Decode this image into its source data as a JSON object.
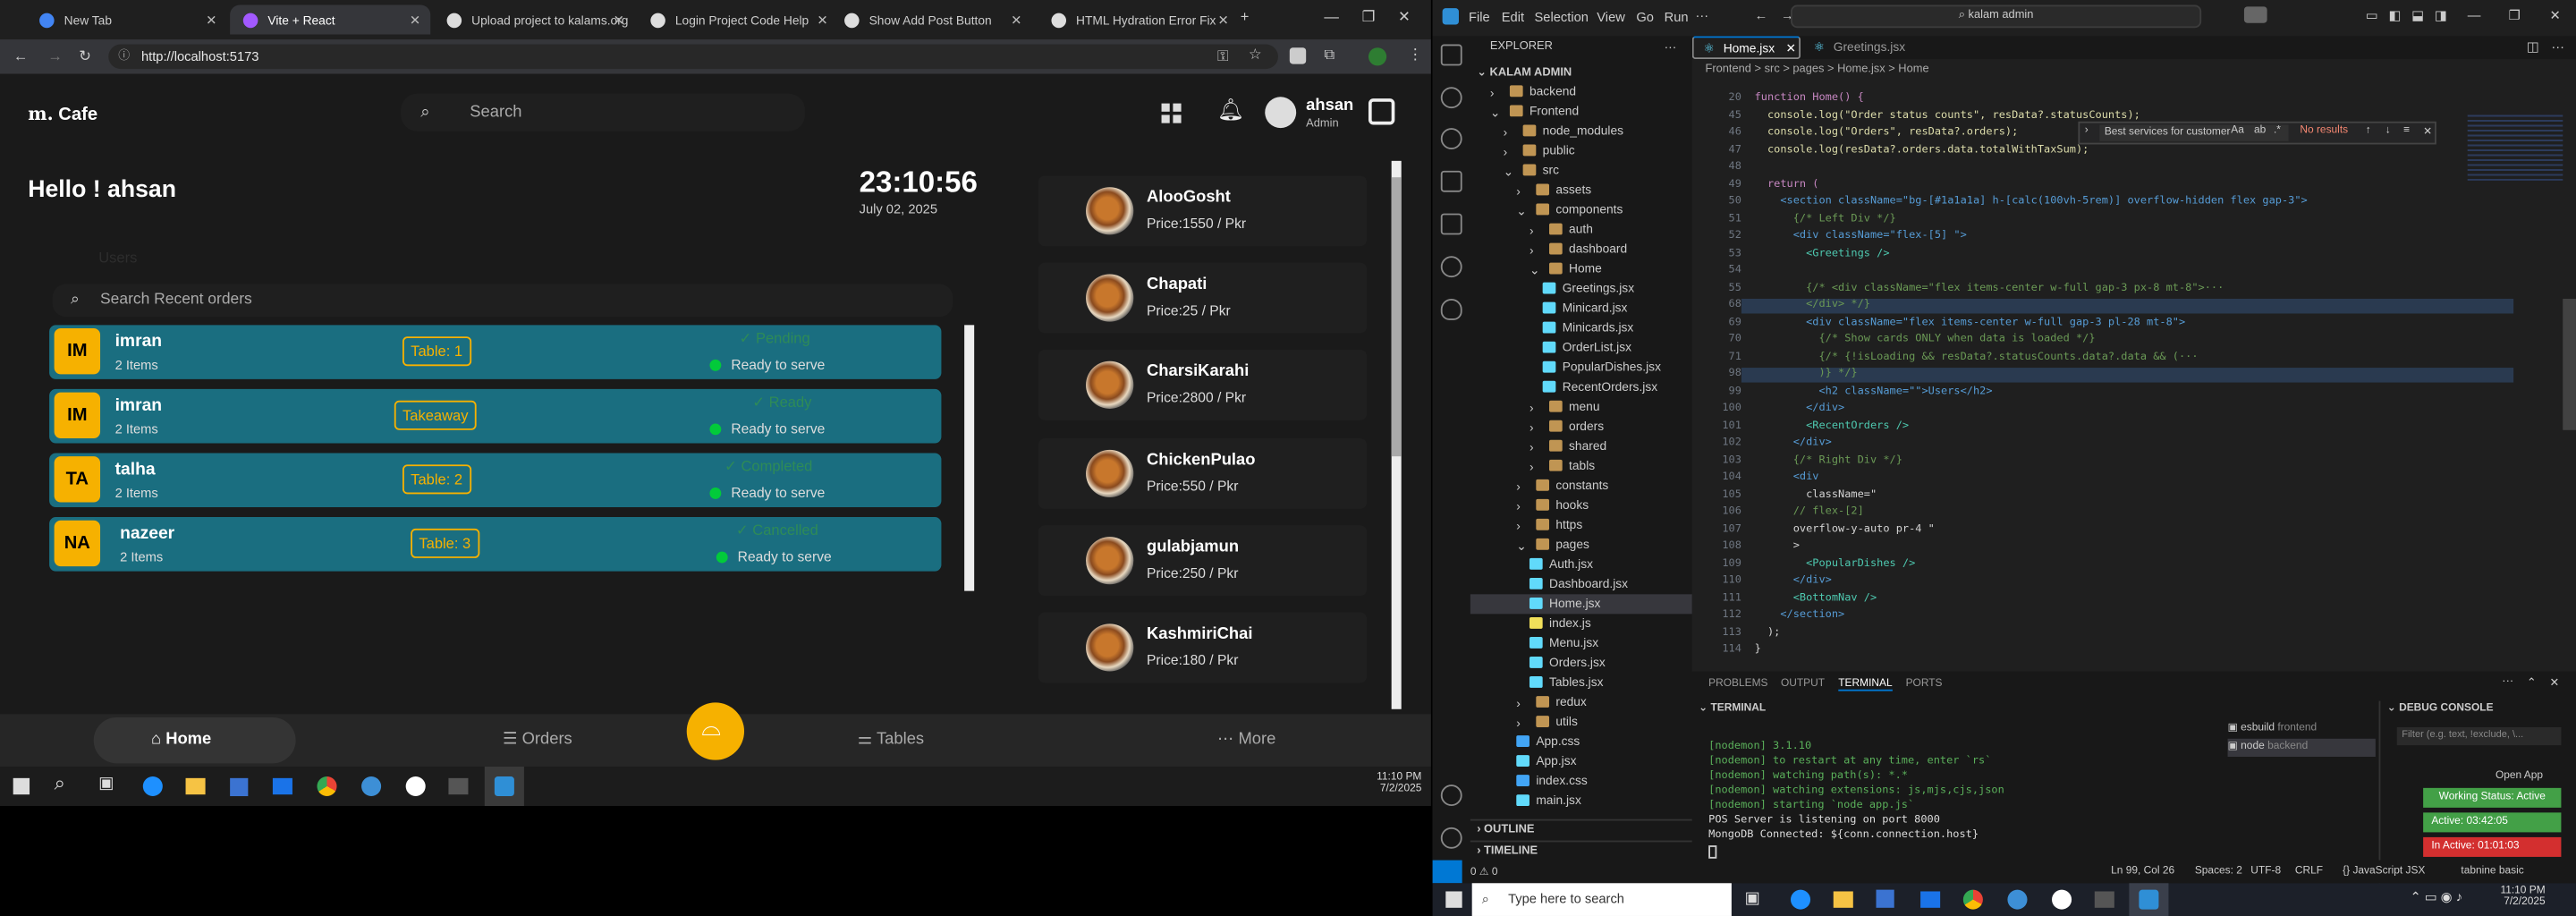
{
  "browser": {
    "tabs": [
      {
        "title": "New Tab"
      },
      {
        "title": "Vite + React"
      },
      {
        "title": "Upload project to kalams.org"
      },
      {
        "title": "Login Project Code Help"
      },
      {
        "title": "Show Add Post Button"
      },
      {
        "title": "HTML Hydration Error Fix"
      }
    ],
    "url": "http://localhost:5173"
  },
  "app": {
    "logo": "Cafe",
    "search_placeholder": "Search",
    "user_name": "ahsan",
    "user_role": "Admin",
    "greeting": "Hello ! ahsan",
    "time": "23:10:56",
    "date": "July 02, 2025",
    "users_label": "Users",
    "recent_search_placeholder": "Search Recent orders",
    "orders": [
      {
        "initials": "IM",
        "name": "imran",
        "items": "2 Items",
        "table": "Table: 1",
        "status": "Pending",
        "ready": "Ready to serve"
      },
      {
        "initials": "IM",
        "name": "imran",
        "items": "2 Items",
        "table": "Takeaway",
        "status": "Ready",
        "ready": "Ready to serve"
      },
      {
        "initials": "TA",
        "name": "talha",
        "items": "2 Items",
        "table": "Table: 2",
        "status": "Completed",
        "ready": "Ready to serve"
      },
      {
        "initials": "NA",
        "name": "nazeer",
        "items": "2 Items",
        "table": "Table: 3",
        "status": "Cancelled",
        "ready": "Ready to serve"
      }
    ],
    "dishes": [
      {
        "name": "AlooGosht",
        "price": "Price:1550 / Pkr"
      },
      {
        "name": "Chapati",
        "price": "Price:25 / Pkr"
      },
      {
        "name": "CharsiKarahi",
        "price": "Price:2800 / Pkr"
      },
      {
        "name": "ChickenPulao",
        "price": "Price:550 / Pkr"
      },
      {
        "name": "gulabjamun",
        "price": "Price:250 / Pkr"
      },
      {
        "name": "KashmiriChai",
        "price": "Price:180 / Pkr"
      }
    ],
    "nav": {
      "home": "Home",
      "orders": "Orders",
      "tables": "Tables",
      "more": "More"
    }
  },
  "taskbar_left": {
    "time": "11:10 PM",
    "date": "7/2/2025"
  },
  "vscode": {
    "menu": [
      "File",
      "Edit",
      "Selection",
      "View",
      "Go",
      "Run"
    ],
    "search": "kalam admin",
    "explorer_title": "EXPLORER",
    "root": "KALAM ADMIN",
    "tree": [
      {
        "label": "backend",
        "depth": 1
      },
      {
        "label": "Frontend",
        "depth": 1
      },
      {
        "label": "node_modules",
        "depth": 2
      },
      {
        "label": "public",
        "depth": 2
      },
      {
        "label": "src",
        "depth": 2
      },
      {
        "label": "assets",
        "depth": 3
      },
      {
        "label": "components",
        "depth": 3
      },
      {
        "label": "auth",
        "depth": 4
      },
      {
        "label": "dashboard",
        "depth": 4
      },
      {
        "label": "Home",
        "depth": 4
      },
      {
        "label": "Greetings.jsx",
        "depth": 5
      },
      {
        "label": "Minicard.jsx",
        "depth": 5
      },
      {
        "label": "Minicards.jsx",
        "depth": 5
      },
      {
        "label": "OrderList.jsx",
        "depth": 5
      },
      {
        "label": "PopularDishes.jsx",
        "depth": 5
      },
      {
        "label": "RecentOrders.jsx",
        "depth": 5
      },
      {
        "label": "menu",
        "depth": 4
      },
      {
        "label": "orders",
        "depth": 4
      },
      {
        "label": "shared",
        "depth": 4
      },
      {
        "label": "tabls",
        "depth": 4
      },
      {
        "label": "constants",
        "depth": 3
      },
      {
        "label": "hooks",
        "depth": 3
      },
      {
        "label": "https",
        "depth": 3
      },
      {
        "label": "pages",
        "depth": 3
      },
      {
        "label": "Auth.jsx",
        "depth": 4
      },
      {
        "label": "Dashboard.jsx",
        "depth": 4
      },
      {
        "label": "Home.jsx",
        "depth": 4
      },
      {
        "label": "index.js",
        "depth": 4
      },
      {
        "label": "Menu.jsx",
        "depth": 4
      },
      {
        "label": "Orders.jsx",
        "depth": 4
      },
      {
        "label": "Tables.jsx",
        "depth": 4
      },
      {
        "label": "redux",
        "depth": 3
      },
      {
        "label": "utils",
        "depth": 3
      },
      {
        "label": "App.css",
        "depth": 3
      },
      {
        "label": "App.jsx",
        "depth": 3
      },
      {
        "label": "index.css",
        "depth": 3
      },
      {
        "label": "main.jsx",
        "depth": 3
      }
    ],
    "outline": "OUTLINE",
    "timeline": "TIMELINE",
    "tabs": [
      "Home.jsx",
      "Greetings.jsx"
    ],
    "breadcrumb": "Frontend > src > pages > Home.jsx > Home",
    "find": {
      "text": "Best services for customer",
      "result": "No results"
    },
    "code": [
      {
        "n": "20",
        "t": "function Home() {"
      },
      {
        "n": "45",
        "t": "  console.log(\"Order status counts\", resData?.statusCounts);"
      },
      {
        "n": "46",
        "t": "  console.log(\"Orders\", resData?.orders);"
      },
      {
        "n": "47",
        "t": "  console.log(resData?.orders.data.totalWithTaxSum);"
      },
      {
        "n": "48",
        "t": ""
      },
      {
        "n": "49",
        "t": "  return ("
      },
      {
        "n": "50",
        "t": "    <section className=\"bg-[#1a1a1a] h-[calc(100vh-5rem)] overflow-hidden flex gap-3\">"
      },
      {
        "n": "51",
        "t": "      {/* Left Div */}"
      },
      {
        "n": "52",
        "t": "      <div className=\"flex-[5] \">"
      },
      {
        "n": "53",
        "t": "        <Greetings />"
      },
      {
        "n": "54",
        "t": ""
      },
      {
        "n": "55",
        "t": "        {/* <div className=\"flex items-center w-full gap-3 px-8 mt-8\">···"
      },
      {
        "n": "68",
        "t": "        </div> */}"
      },
      {
        "n": "69",
        "t": "        <div className=\"flex items-center w-full gap-3 pl-28 mt-8\">"
      },
      {
        "n": "70",
        "t": "          {/* Show cards ONLY when data is loaded */}"
      },
      {
        "n": "71",
        "t": "          {/* {!isLoading && resData?.statusCounts.data?.data && (···"
      },
      {
        "n": "98",
        "t": "          )} */}"
      },
      {
        "n": "99",
        "t": "          <h2 className=\"\">Users</h2>"
      },
      {
        "n": "100",
        "t": "        </div>"
      },
      {
        "n": "101",
        "t": "        <RecentOrders />"
      },
      {
        "n": "102",
        "t": "      </div>"
      },
      {
        "n": "103",
        "t": "      {/* Right Div */}"
      },
      {
        "n": "104",
        "t": "      <div"
      },
      {
        "n": "105",
        "t": "        className=\""
      },
      {
        "n": "106",
        "t": "      // flex-[2]"
      },
      {
        "n": "107",
        "t": "      overflow-y-auto pr-4 \""
      },
      {
        "n": "108",
        "t": "      >"
      },
      {
        "n": "109",
        "t": "        <PopularDishes />"
      },
      {
        "n": "110",
        "t": "      </div>"
      },
      {
        "n": "111",
        "t": "      <BottomNav />"
      },
      {
        "n": "112",
        "t": "    </section>"
      },
      {
        "n": "113",
        "t": "  );"
      },
      {
        "n": "114",
        "t": "}"
      }
    ],
    "panel_tabs": [
      "PROBLEMS",
      "OUTPUT",
      "TERMINAL",
      "PORTS"
    ],
    "terminal_label": "TERMINAL",
    "debug_label": "DEBUG CONSOLE",
    "debug_filter": "Filter (e.g. text, !exclude, \\...",
    "terminal_lines": [
      "[nodemon] 3.1.10",
      "[nodemon] to restart at any time, enter `rs`",
      "[nodemon] watching path(s): *.*",
      "[nodemon] watching extensions: js,mjs,cjs,json",
      "[nodemon] starting `node app.js`",
      "POS Server is listening on port 8000",
      "MongoDB Connected: ${conn.connection.host}"
    ],
    "terminals": [
      {
        "name": "esbuild",
        "sub": "frontend"
      },
      {
        "name": "node",
        "sub": "backend"
      }
    ],
    "open_app": "Open App",
    "working": "Working Status: Active",
    "active": "Active: 03:42:05",
    "inactive": "In Active: 01:01:03",
    "status": {
      "left": "0 ⚠ 0",
      "pos": "Ln 99, Col 26",
      "spaces": "Spaces: 2",
      "enc": "UTF-8",
      "eol": "CRLF",
      "lang": "JavaScript JSX",
      "tabnine": "tabnine basic"
    }
  },
  "taskbar_right": {
    "search": "Type here to search",
    "time": "11:10 PM",
    "date": "7/2/2025"
  }
}
